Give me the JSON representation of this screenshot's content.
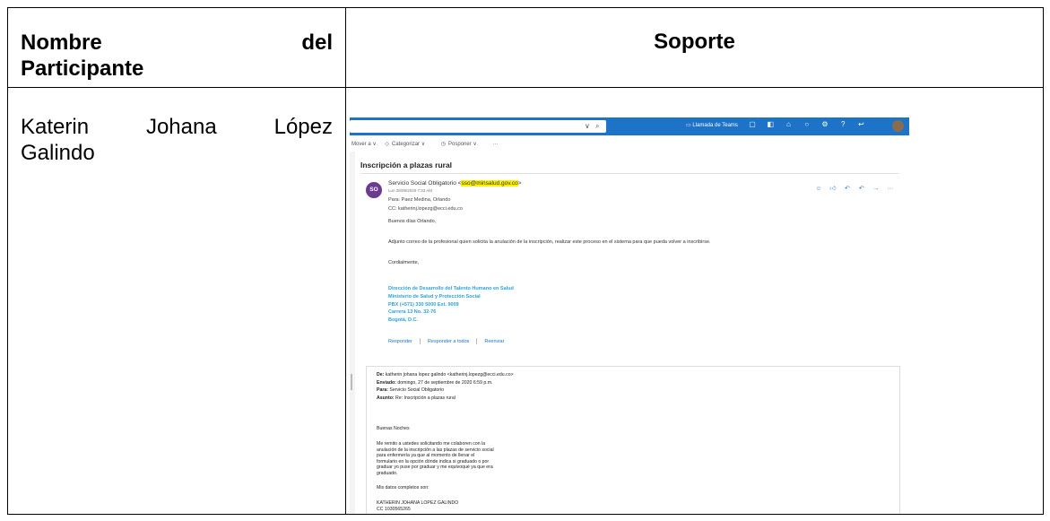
{
  "table": {
    "header": {
      "col1_word1": "Nombre",
      "col1_word2": "del",
      "col1_line2": "Participante",
      "col2": "Soporte"
    },
    "row": {
      "name_w1": "Katerin",
      "name_w2": "Johana",
      "name_w3": "López",
      "name_line2": "Galindo"
    }
  },
  "email": {
    "search_arrow": "∨",
    "search_icon": "search-icon",
    "teams_label": "Llamada de Teams",
    "commands": [
      "Mover a ∨",
      "Categorizar ∨",
      "Posponer ∨",
      "···"
    ],
    "subject": "Inscripción a plazas rural",
    "avatar_initials": "SO",
    "sender_name": "Servicio Social Obligatorio <",
    "sender_email": "sso@minsalud.gov.co",
    "sender_close": ">",
    "datetime": "Lun 28/09/2020 7:33 AM",
    "to": "Para:  Paez Medina, Orlando",
    "cc": "CC:  katherinj.lopezg@ecci.edu.co",
    "greeting": "Buenos días Orlando,",
    "body": "Adjunto correo de la profesional quien solicita la anulación de la inscripción, realizar este proceso en el sistema para que pueda volver a inscribirse.",
    "closing": "Cordialmente,",
    "signature": [
      "Dirección de Desarrollo del Talento Humano en Salud",
      "Ministerio de Salud y Protección Social",
      "PBX (+571) 330 5000 Ext. 9009",
      "Carrera 13 No. 32-76",
      "Bogotá, D.C."
    ],
    "reply": "Responder",
    "reply_all": "Responder a todos",
    "forward": "Reenviar",
    "quoted": {
      "from_label": "De:",
      "from": " katherin johana lopez galindo <katherinj.lopezg@ecci.edu.co>",
      "sent_label": "Enviado:",
      "sent": " domingo, 27 de septiembre de 2020 6:59 p.m.",
      "to_label": "Para:",
      "to": " Servicio Social Obligatorio",
      "subject_label": "Asunto:",
      "subject": " Re: Inscripción a plazas rural",
      "greeting": "Buenas Noches",
      "body_lines": [
        "Me remito a ustedes solicitando me colaboren con la",
        "anulación de la inscripción a las plazas de servicio social",
        "para enfermería ya que al momento de llenar el",
        "formulario en la opción dónde indica si graduado o por",
        "graduar yo puse por graduar y me equivoqué ya que era",
        "graduado."
      ],
      "data_line": "Mis datos completos son:",
      "full_name": "KATHERIN JOHANA LOPEZ GALINDO",
      "cc": "CC 1030565265"
    }
  }
}
